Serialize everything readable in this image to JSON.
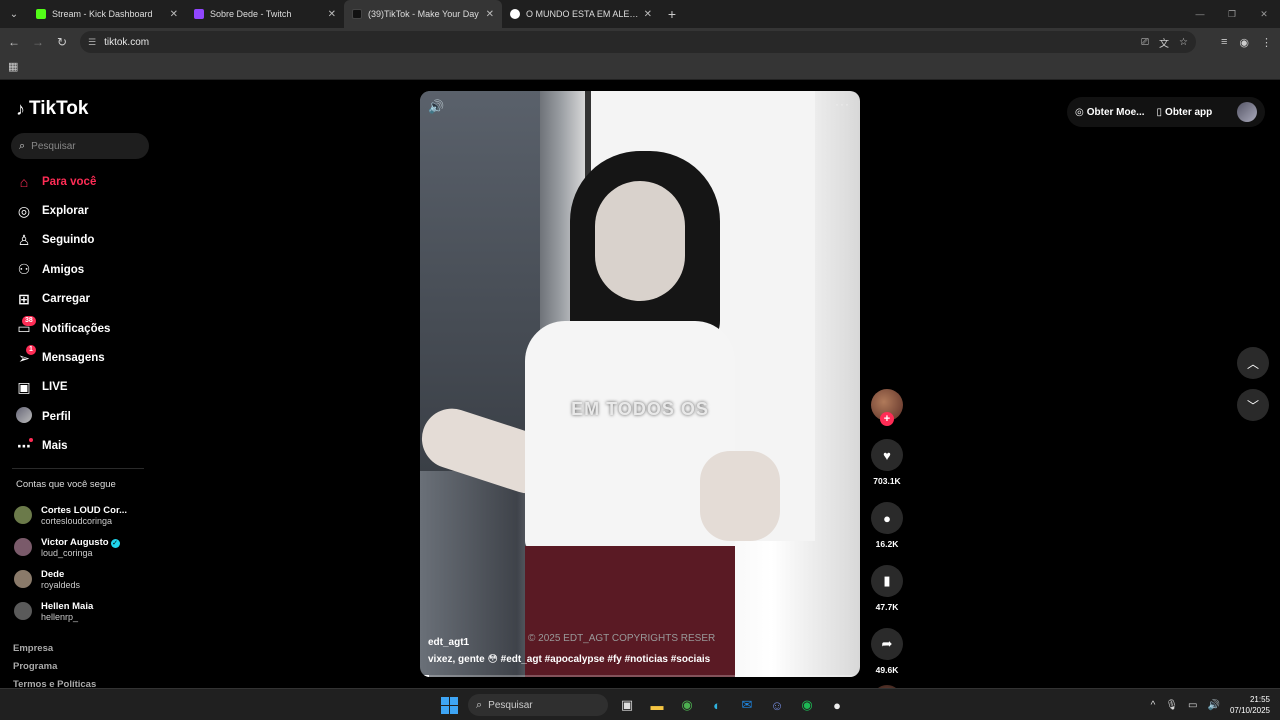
{
  "browser": {
    "tabs": [
      {
        "title": "Stream - Kick Dashboard",
        "color": "#53fc18",
        "active": false
      },
      {
        "title": "Sobre Dede - Twitch",
        "color": "#9146ff",
        "active": false
      },
      {
        "title": "(39)TikTok - Make Your Day",
        "color": "#111111",
        "active": true
      },
      {
        "title": "O MUNDO ESTA EM ALERTA GL",
        "color": "#ffffff",
        "active": false
      }
    ],
    "url": "tiktok.com"
  },
  "tiktok": {
    "brand": "TikTok",
    "search_placeholder": "Pesquisar",
    "nav": [
      {
        "label": "Para você",
        "icon": "home-icon",
        "glyph": "⌂"
      },
      {
        "label": "Explorar",
        "icon": "compass-icon",
        "glyph": "◎"
      },
      {
        "label": "Seguindo",
        "icon": "following-icon",
        "glyph": "♙"
      },
      {
        "label": "Amigos",
        "icon": "friends-icon",
        "glyph": "⚇"
      },
      {
        "label": "Carregar",
        "icon": "upload-icon",
        "glyph": "⊞"
      },
      {
        "label": "Notificações",
        "icon": "inbox-icon",
        "glyph": "▭",
        "badge": "38"
      },
      {
        "label": "Mensagens",
        "icon": "messages-icon",
        "glyph": "➢",
        "badge": "1"
      },
      {
        "label": "LIVE",
        "icon": "live-icon",
        "glyph": "▣"
      },
      {
        "label": "Perfil",
        "icon": "profile-avatar-icon",
        "glyph": ""
      },
      {
        "label": "Mais",
        "icon": "more-icon",
        "glyph": "⋯"
      }
    ],
    "following_title": "Contas que você segue",
    "following": [
      {
        "name": "Cortes LOUD Cor...",
        "handle": "cortesloudcoringa",
        "verified": false,
        "color": "#6b7a4a"
      },
      {
        "name": "Victor Augusto",
        "handle": "loud_coringa",
        "verified": true,
        "color": "#7a5a6a"
      },
      {
        "name": "Dede",
        "handle": "royaldeds",
        "verified": false,
        "color": "#8a7a6a"
      },
      {
        "name": "Hellen Maia",
        "handle": "hellenrp_",
        "verified": false,
        "color": "#5a5a5a"
      }
    ],
    "footer": [
      "Empresa",
      "Programa",
      "Termos e Políticas"
    ],
    "top_actions": {
      "coins": "Obter Moe...",
      "app": "Obter app"
    },
    "video": {
      "caption_overlay": "EM TODOS OS",
      "copyright": "© 2025 EDT_AGT COPYRIGHTS RESER",
      "author": "edt_agt1",
      "description": "vixez, gente 😳 #edt_agt #apocalypse #fy #noticias #sociais",
      "progress": 0.02
    },
    "actions": {
      "likes": "703.1K",
      "comments": "16.2K",
      "saves": "47.7K",
      "shares": "49.6K"
    }
  },
  "taskbar": {
    "search_placeholder": "Pesquisar",
    "time": "21:55",
    "date": "07/10/2025"
  }
}
